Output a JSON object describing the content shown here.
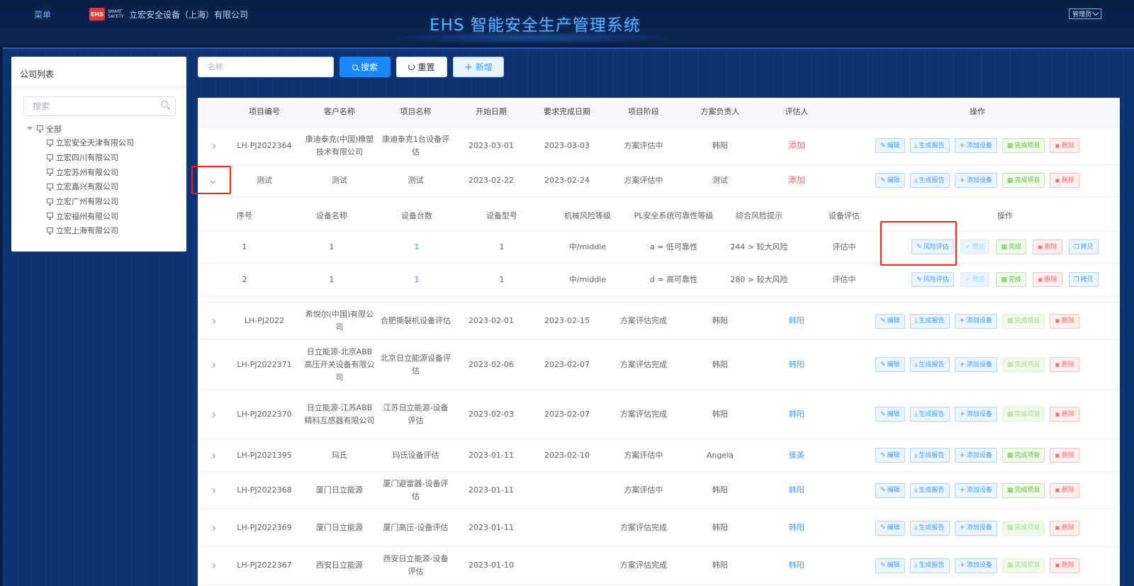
{
  "header": {
    "menu_label": "菜单",
    "logo_text": "EHS",
    "logo_sub_1": "SMART",
    "logo_sub_2": "SAFETY",
    "company": "立宏安全设备（上海）有限公司",
    "title": "EHS 智能安全生产管理系统",
    "user_menu": "管理员"
  },
  "left_panel": {
    "title": "公司列表",
    "search_placeholder": "搜索",
    "root": "全部",
    "companies": [
      "立宏安全天津有限公司",
      "立宏四川有限公司",
      "立宏苏州有限公司",
      "立宏嘉兴有限公司",
      "立宏广州有限公司",
      "立宏福州有限公司",
      "立宏上海有限公司"
    ]
  },
  "toolbar": {
    "name_placeholder": "名称",
    "search_label": "搜索",
    "reset_label": "重置",
    "add_label": "新增"
  },
  "table": {
    "columns": [
      "项目编号",
      "客户名称",
      "项目名称",
      "开始日期",
      "要求完成日期",
      "项目阶段",
      "方案负责人",
      "评估人",
      "操作"
    ],
    "actions": {
      "edit": "编辑",
      "report": "生成报告",
      "add_device": "添加设备",
      "complete": "完成项目",
      "delete": "删除"
    },
    "rows": [
      {
        "id": "LH-PJ2022364",
        "customer": "康迪泰克(中国)橡塑技术有限公司",
        "project": "康迪泰克1台设备评估",
        "start": "2023-03-01",
        "due": "2023-03-03",
        "stage": "方案评估中",
        "owner": "韩阳",
        "assessor": "添加",
        "complete_enabled": true
      },
      {
        "id": "测试",
        "customer": "测试",
        "project": "测试",
        "start": "2023-02-22",
        "due": "2023-02-24",
        "stage": "方案评估中",
        "owner": "测试",
        "assessor": "添加",
        "complete_enabled": true
      },
      {
        "id": "LH-PJ2022",
        "customer": "希悦尔(中国)有限公司",
        "project": "合肥撕裂机设备评估",
        "start": "2023-02-01",
        "due": "2023-02-15",
        "stage": "方案评估完成",
        "owner": "韩阳",
        "assessor": "韩阳",
        "complete_enabled": false
      },
      {
        "id": "LH-PJ2022371",
        "customer": "日立能源-北京ABB高压开关设备有限公司",
        "project": "北京日立能源设备评估",
        "start": "2023-02-06",
        "due": "2023-02-07",
        "stage": "方案评估完成",
        "owner": "韩阳",
        "assessor": "韩阳",
        "complete_enabled": false
      },
      {
        "id": "LH-PJ2022370",
        "customer": "日立能源-江苏ABB精科互感器有限公司",
        "project": "江苏日立能源-设备评估",
        "start": "2023-02-03",
        "due": "2023-02-07",
        "stage": "方案评估完成",
        "owner": "韩阳",
        "assessor": "韩阳",
        "complete_enabled": false
      },
      {
        "id": "LH-PJ2021395",
        "customer": "玛氏",
        "project": "玛氏设备评估",
        "start": "2023-01-11",
        "due": "2023-02-10",
        "stage": "方案评估中",
        "owner": "Angela",
        "assessor": "侯英",
        "complete_enabled": true
      },
      {
        "id": "LH-PJ2022368",
        "customer": "厦门日立能源",
        "project": "厦门避雷器-设备评估",
        "start": "2023-01-11",
        "due": "",
        "stage": "方案评估中",
        "owner": "韩阳",
        "assessor": "韩阳",
        "complete_enabled": true
      },
      {
        "id": "LH-PJ2022369",
        "customer": "厦门日立能源",
        "project": "厦门高压-设备评估",
        "start": "2023-01-11",
        "due": "",
        "stage": "方案评估完成",
        "owner": "韩阳",
        "assessor": "韩阳",
        "complete_enabled": false
      },
      {
        "id": "LH-PJ2022367",
        "customer": "西安日立能源",
        "project": "西安日立能源-设备评估",
        "start": "2023-01-10",
        "due": "",
        "stage": "方案评估完成",
        "owner": "韩阳",
        "assessor": "韩阳",
        "complete_enabled": false
      }
    ]
  },
  "subtable": {
    "columns": [
      "序号",
      "设备名称",
      "设备台数",
      "设备型号",
      "机械风险等级",
      "PL安全系统可靠性等级",
      "综合风险提示",
      "设备评估",
      "操作"
    ],
    "actions": {
      "risk": "风险评估",
      "preview": "预览",
      "done": "完成",
      "delete": "删除",
      "copy": "拷贝"
    },
    "rows": [
      {
        "no": "1",
        "name": "1",
        "count": "1",
        "model": "1",
        "mech_risk": "中/middle",
        "pl": "a = 低可靠性",
        "hint": "244 > 较大风险",
        "eval": "评估中"
      },
      {
        "no": "2",
        "name": "1",
        "count": "1",
        "model": "1",
        "mech_risk": "中/middle",
        "pl": "d = 高可靠性",
        "hint": "280 > 较大风险",
        "eval": "评估中"
      }
    ]
  },
  "colors": {
    "header_bg": "#0a1f47",
    "workspace_bg": "#0d3373",
    "title": "#5ab2ff",
    "primary": "#1989fa",
    "danger": "#f56c6c",
    "success": "#67c23a",
    "highlight": "#ff1f1f"
  }
}
